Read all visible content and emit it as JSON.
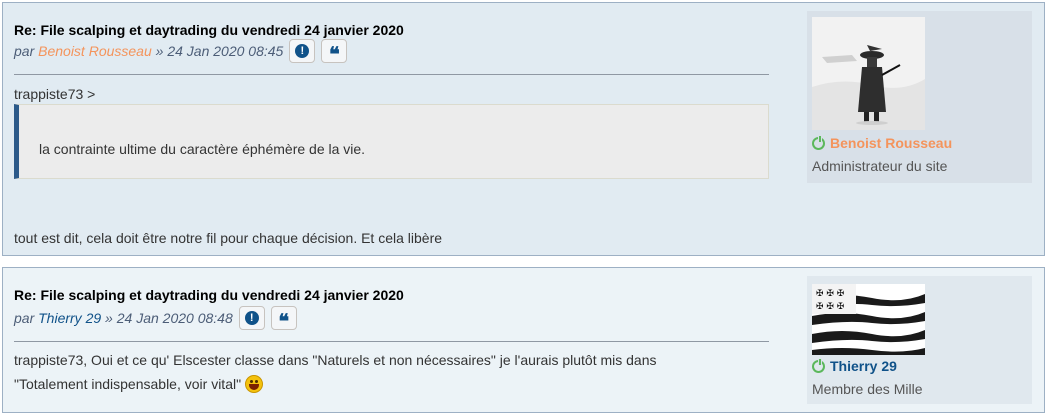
{
  "posts": [
    {
      "title": "Re: File scalping et daytrading du vendredi 24 janvier 2020",
      "by": "par",
      "author": "Benoist Rousseau",
      "date_sep": "»",
      "date": "24 Jan 2020 08:45",
      "report_icon": "exclamation-icon",
      "quote_icon": "quote-icon",
      "reply_to": "trappiste73 >",
      "quote_text": "la contrainte ultime du caractère éphémère de la vie.",
      "body": "tout est dit, cela doit être notre fil pour chaque décision. Et cela libère",
      "profile": {
        "name": "Benoist Rousseau",
        "rank": "Administrateur du site",
        "name_color": "#f4945c"
      }
    },
    {
      "title": "Re: File scalping et daytrading du vendredi 24 janvier 2020",
      "by": "par",
      "author": "Thierry 29",
      "date_sep": "»",
      "date": "24 Jan 2020 08:48",
      "body_line1": "trappiste73, Oui et ce qu' Elscester classe dans \"Naturels et non nécessaires\" je l'aurais plutôt mis dans",
      "body_line2": "\"Totalement indispensable, voir vital\"",
      "smiley": "laughing-smiley-icon",
      "profile": {
        "name": "Thierry 29",
        "rank": "Membre des Mille",
        "name_color": "#105289"
      }
    }
  ],
  "colors": {
    "post1_bg": "#e1ebf2",
    "post2_bg": "#ecf3f7",
    "link_blue": "#105289",
    "admin_orange": "#f4945c",
    "online_green": "#5cb85c"
  }
}
